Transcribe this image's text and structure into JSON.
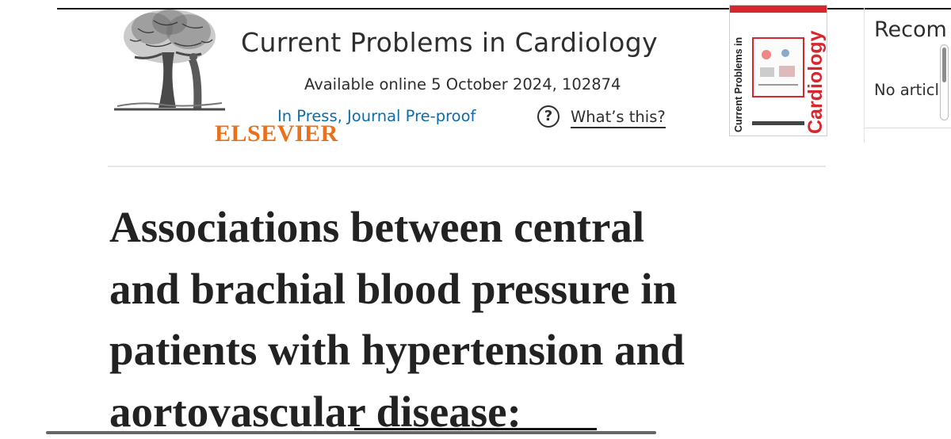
{
  "header": {
    "publisher": "ELSEVIER",
    "journal_title": "Current Problems in Cardiology",
    "online_date": "Available online 5 October 2024, 102874",
    "status": "In Press, Journal Pre-proof",
    "help_icon": "?",
    "help_link": "What’s this?"
  },
  "cover": {
    "spine_text": "Current Problems in",
    "title": "Cardiology"
  },
  "article": {
    "title": "Associations between central\nand brachial blood pressure in\npatients with hypertension and\naortovascular disease:"
  },
  "sidebar": {
    "heading": "Recom",
    "empty_text": "No articl"
  },
  "colors": {
    "publisher_orange": "#e9711c",
    "link_blue": "#0c6dab",
    "cover_red": "#d7262e",
    "text": "#222222"
  },
  "icons": [
    "elsevier-tree-logo-icon",
    "help-circle-icon"
  ]
}
